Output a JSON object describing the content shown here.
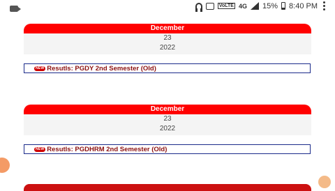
{
  "status_bar": {
    "network": "4G",
    "battery": "15%",
    "time": "8:40 PM"
  },
  "cards": [
    {
      "month": "December",
      "day": "23",
      "year": "2022",
      "badge": "NEW",
      "result": "Resutls: PGDY 2nd Semester (Old)"
    },
    {
      "month": "December",
      "day": "23",
      "year": "2022",
      "badge": "NEW",
      "result": "Resutls: PGDHRM 2nd Semester (Old)"
    }
  ]
}
